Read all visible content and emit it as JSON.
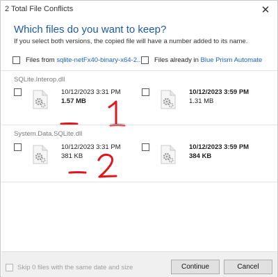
{
  "window": {
    "title": "2 Total File Conflicts",
    "close_glyph": "✕"
  },
  "heading": "Which files do you want to keep?",
  "subtext": "If you select both versions, the copied file will have a number added to its name.",
  "columns": {
    "left": {
      "prefix": "Files from ",
      "link": "sqlite-netFx40-binary-x64-2..."
    },
    "right": {
      "prefix": "Files already in ",
      "link": "Blue Prism Automate"
    }
  },
  "conflicts": [
    {
      "name": "SQLite.Interop.dll",
      "left": {
        "date": "10/12/2023 3:31 PM",
        "size": "1.57 MB"
      },
      "right": {
        "date": "10/12/2023 3:59 PM",
        "size": "1.31 MB"
      }
    },
    {
      "name": "System.Data.SQLite.dll",
      "left": {
        "date": "10/12/2023 3:31 PM",
        "size": "381 KB"
      },
      "right": {
        "date": "10/12/2023 3:59 PM",
        "size": "384 KB"
      }
    }
  ],
  "annotations": {
    "mark_1": "1",
    "mark_2": "2",
    "color": "#e3141b"
  },
  "footer": {
    "skip_label": "Skip 0 files with the same date and size",
    "continue_label": "Continue",
    "cancel_label": "Cancel"
  },
  "colors": {
    "heading": "#1c5aa6",
    "link": "#1c63c3",
    "annotation": "#e3141b"
  },
  "icons": [
    "close-icon",
    "file-gear-icon",
    "checkbox-icon"
  ]
}
